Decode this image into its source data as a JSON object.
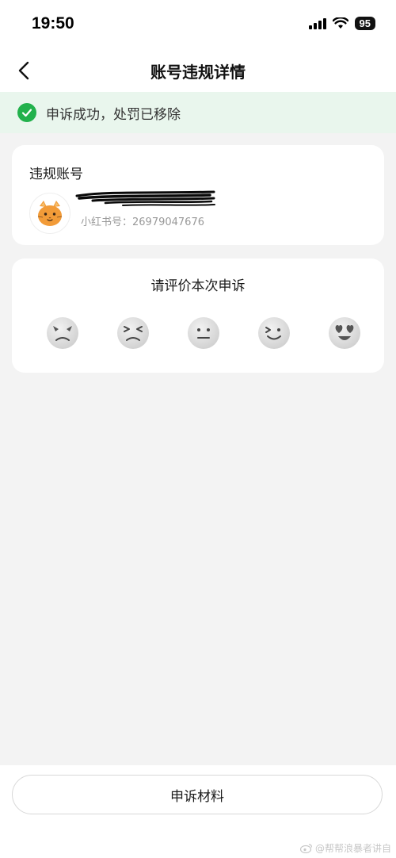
{
  "status_bar": {
    "time": "19:50",
    "battery": "95"
  },
  "nav": {
    "title": "账号违规详情"
  },
  "banner": {
    "text": "申诉成功，处罚已移除"
  },
  "account_card": {
    "title": "违规账号",
    "xhs_id": "小红书号：26979047676"
  },
  "rating_card": {
    "title": "请评价本次申诉",
    "faces": [
      "angry-face-icon",
      "upset-face-icon",
      "neutral-face-icon",
      "smiling-face-icon",
      "heart-eyes-face-icon"
    ]
  },
  "bottom": {
    "button_label": "申诉材料"
  },
  "watermark": {
    "text": "@帮帮浪暴者讲自"
  },
  "colors": {
    "success": "#22b14c",
    "banner_bg": "#e9f6ed",
    "page_bg": "#f3f3f3"
  }
}
